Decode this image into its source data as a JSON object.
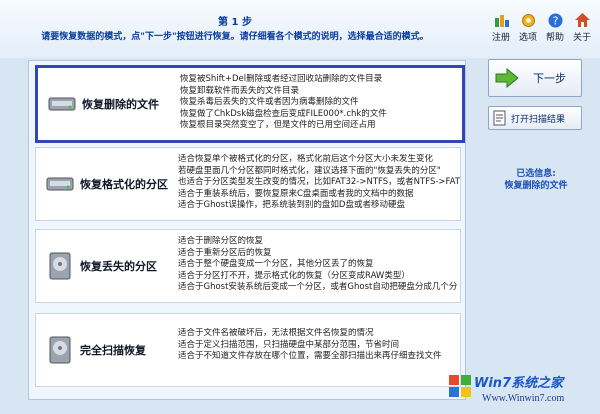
{
  "header": {
    "step": "第 1 步",
    "instruction": "请要恢复数据的模式，点\"下一步\"按钮进行恢复。请仔细看各个模式的说明，选择最合适的模式。"
  },
  "toolbar": [
    {
      "label": "注册",
      "icon": "register-icon"
    },
    {
      "label": "选项",
      "icon": "options-gear-icon"
    },
    {
      "label": "帮助",
      "icon": "help-icon"
    },
    {
      "label": "关于",
      "icon": "about-house-icon"
    }
  ],
  "modes": [
    {
      "title": "恢复删除的文件",
      "selected": true,
      "icon": "hard-disk-icon",
      "desc": [
        "恢复被Shift+Del删除或者经过回收站删除的文件目录",
        "恢复卸载软件而丢失的文件目录",
        "恢复杀毒后丢失的文件或者因为病毒删除的文件",
        "恢复做了ChkDsk磁盘检查后变成FILE000*.chk的文件",
        "恢复根目录突然变空了，但是文件的已用空间还占用"
      ]
    },
    {
      "title": "恢复格式化的分区",
      "selected": false,
      "icon": "hard-disk-icon",
      "desc": [
        "适合恢复单个被格式化的分区，格式化前后这个分区大小未发生变化",
        "若硬盘里面几个分区都同时格式化，建议选择下面的\"恢复丢失的分区\"",
        "也适合于分区类型发生改变的情况，比如FAT32->NTFS，或者NTFS->FAT3",
        "适合于重装系统后，要恢复原来C盘桌面或者我的文档中的数据",
        "适合于Ghost误操作，把系统装到别的盘如D盘或者移动硬盘"
      ]
    },
    {
      "title": "恢复丢失的分区",
      "selected": false,
      "icon": "hard-disk-icon",
      "desc": [
        "适合于删除分区的恢复",
        "适合于重新分区后的恢复",
        "适合于整个硬盘变成一个分区，其他分区丢了的恢复",
        "适合于分区打不开，提示格式化的恢复（分区变成RAW类型）",
        "适合于Ghost安装系统后变成一个分区，或者Ghost自动把硬盘分成几个分"
      ]
    },
    {
      "title": "完全扫描恢复",
      "selected": false,
      "icon": "hard-disk-icon",
      "desc": [
        "适合于文件名被破坏后，无法根据文件名恢复的情况",
        "适合于定义扫描范围，只扫描硬盘中某部分范围，节省时间",
        "适合于不知道文件存放在哪个位置，需要全部扫描出来再仔细查找文件"
      ]
    }
  ],
  "buttons": {
    "next": "下一步",
    "open_scan": "打开扫描结果"
  },
  "selected_info": {
    "label": "已选信息:",
    "value": "恢复删除的文件"
  },
  "watermark": {
    "logo": "Win7系统之家",
    "url": "Www.Winwin7.com"
  }
}
